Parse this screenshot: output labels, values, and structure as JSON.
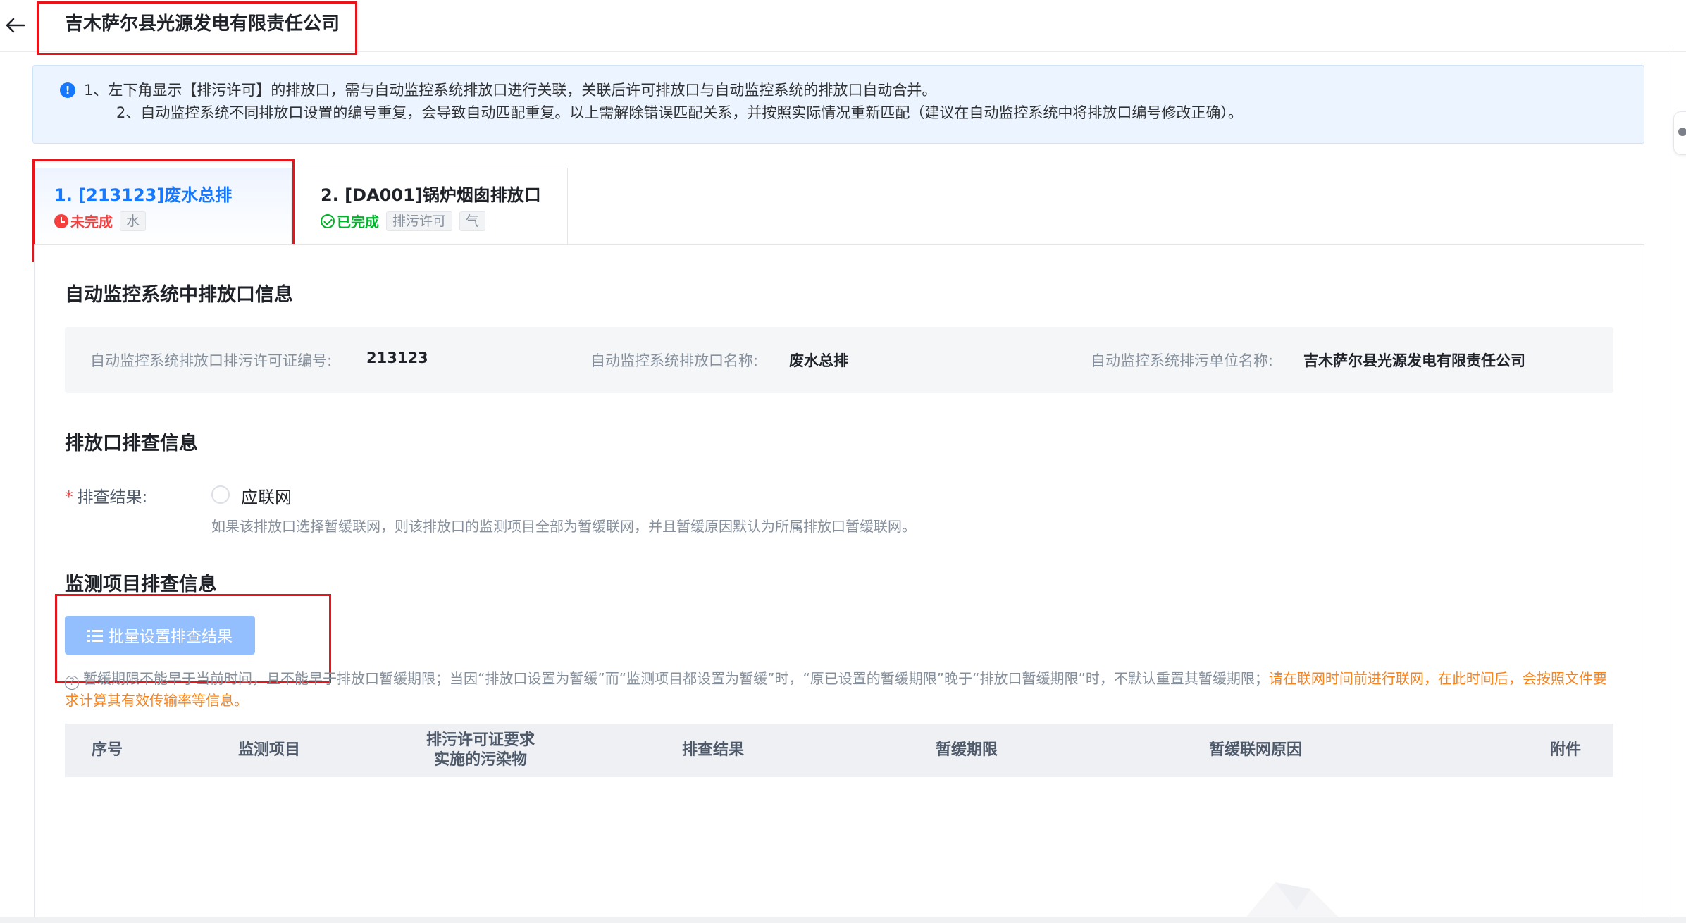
{
  "header": {
    "title": "吉木萨尔县光源发电有限责任公司"
  },
  "notice": {
    "icon": "info-icon",
    "line1": "1、左下角显示【排污许可】的排放口，需与自动监控系统排放口进行关联，关联后许可排放口与自动监控系统的排放口自动合并。",
    "line2": "2、自动监控系统不同排放口设置的编号重复，会导致自动匹配重复。以上需解除错误匹配关系，并按照实际情况重新匹配（建议在自动监控系统中将排放口编号修改正确）。"
  },
  "tabs": [
    {
      "title": "1. [213123]废水总排",
      "status": "未完成",
      "tags": [
        "水"
      ],
      "active": true
    },
    {
      "title": "2. [DA001]锅炉烟囱排放口",
      "status": "已完成",
      "tags": [
        "排污许可",
        "气"
      ],
      "active": false
    }
  ],
  "auto_monitor": {
    "section_title": "自动监控系统中排放口信息",
    "permit_no_label": "自动监控系统排放口排污许可证编号:",
    "permit_no_value": "213123",
    "outlet_name_label": "自动监控系统排放口名称:",
    "outlet_name_value": "废水总排",
    "unit_name_label": "自动监控系统排污单位名称:",
    "unit_name_value": "吉木萨尔县光源发电有限责任公司"
  },
  "outlet_check": {
    "section_title": "排放口排查信息",
    "required_mark": "*",
    "result_label": "排查结果:",
    "radio_option": "应联网",
    "hint": "如果该排放口选择暂缓联网，则该排放口的监测项目全部为暂缓联网，并且暂缓原因默认为所属排放口暂缓联网。"
  },
  "monitor_items": {
    "section_title": "监测项目排查信息",
    "batch_button": "批量设置排查结果",
    "tip_text": "暂缓期限不能早于当前时间，且不能早于排放口暂缓期限；当因“排放口设置为暂缓”而“监测项目都设置为暂缓”时，“原已设置的暂缓期限”晚于“排放口暂缓期限”时，不默认重置其暂缓期限；",
    "tip_warning": "请在联网时间前进行联网，在此时间后，会按照文件要求计算其有效传输率等信息。",
    "columns": [
      "序号",
      "监测项目",
      "排污许可证要求\n实施的污染物",
      "排查结果",
      "暂缓期限",
      "暂缓联网原因",
      "附件"
    ]
  },
  "colors": {
    "accent": "#1677ff",
    "danger": "#f53f3f",
    "success": "#00b42a",
    "warning": "#f7831d",
    "highlight_box": "#e8141a"
  }
}
